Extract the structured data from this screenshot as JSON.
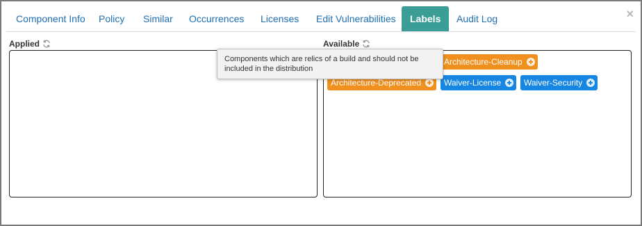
{
  "tabs": [
    {
      "label": "Component Info",
      "active": false
    },
    {
      "label": "Policy",
      "active": false
    },
    {
      "label": "Similar",
      "active": false
    },
    {
      "label": "Occurrences",
      "active": false
    },
    {
      "label": "Licenses",
      "active": false
    },
    {
      "label": "Edit Vulnerabilities",
      "active": false
    },
    {
      "label": "Labels",
      "active": true
    },
    {
      "label": "Audit Log",
      "active": false
    }
  ],
  "close_label": "×",
  "applied": {
    "title": "Applied",
    "items": []
  },
  "available": {
    "title": "Available",
    "items": [
      {
        "label": "Architecture-Cleanup",
        "color": "#f0901e"
      },
      {
        "label": "Architecture-Deprecated",
        "color": "#f0901e"
      },
      {
        "label": "Waiver-License",
        "color": "#1786e3"
      },
      {
        "label": "Waiver-Security",
        "color": "#1786e3"
      }
    ]
  },
  "tooltip": {
    "text": "Components which are relics of a build and should not be included in the distribution"
  },
  "colors": {
    "tab_link": "#1f6fb2",
    "tab_active_bg": "#3a9d96",
    "orange": "#f0901e",
    "blue": "#1786e3"
  }
}
